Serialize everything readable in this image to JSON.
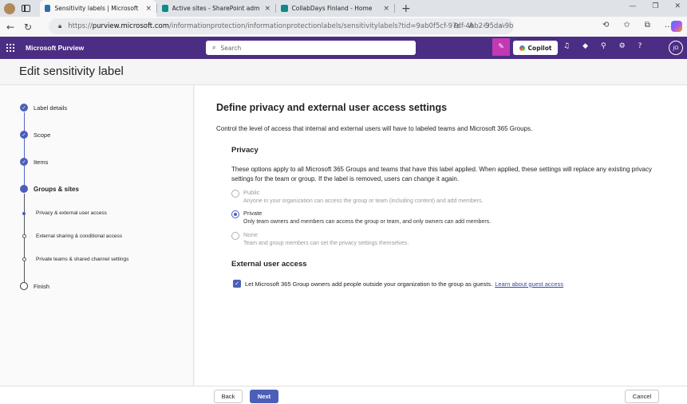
{
  "browser": {
    "tabs": [
      {
        "label": "Sensitivity labels | Microsoft Purv...",
        "active": true,
        "favicon_color": "#2b6cb0"
      },
      {
        "label": "Active sites - SharePoint admin c...",
        "active": false,
        "favicon_color": "#0f8a8a"
      },
      {
        "label": "CollabDays Finland - Home",
        "active": false,
        "favicon_color": "#0f8a8a"
      }
    ],
    "close_glyph": "×",
    "new_tab_glyph": "+",
    "url_prefix": "https://",
    "url_host": "purview.microsoft.com",
    "url_path": "/informationprotection/informationprotectionlabels/sensitivitylabels?tid=9ab0f5cf-97df-4bb2-95da-9bb492a2..."
  },
  "app": {
    "name": "Microsoft Purview",
    "search_placeholder": "Search",
    "copilot_label": "Copilot",
    "avatar_initials": "JO",
    "brand_color": "#4b2e83",
    "accent_color": "#4c5fb8"
  },
  "page": {
    "title": "Edit sensitivity label"
  },
  "stepper": {
    "steps": [
      {
        "label": "Label details",
        "state": "done"
      },
      {
        "label": "Scope",
        "state": "done"
      },
      {
        "label": "Items",
        "state": "done"
      },
      {
        "label": "Groups & sites",
        "state": "current"
      },
      {
        "label": "Privacy & external user access",
        "state": "sub-current"
      },
      {
        "label": "External sharing & conditional access",
        "state": "sub"
      },
      {
        "label": "Private teams & shared channel settings",
        "state": "sub"
      },
      {
        "label": "Finish",
        "state": "todo"
      }
    ]
  },
  "main": {
    "heading": "Define privacy and external user access settings",
    "intro": "Control the level of access that internal and external users will have to labeled teams and Microsoft 365 Groups.",
    "privacy": {
      "heading": "Privacy",
      "description": "These options apply to all Microsoft 365 Groups and teams that have this label applied. When applied, these settings will replace any existing privacy settings for the team or group. If the label is removed, users can change it again.",
      "options": [
        {
          "title": "Public",
          "description": "Anyone in your organization can access the group or team (including content) and add members.",
          "selected": false
        },
        {
          "title": "Private",
          "description": "Only team owners and members can access the group or team, and only owners can add members.",
          "selected": true
        },
        {
          "title": "None",
          "description": "Team and group members can set the privacy settings themselves.",
          "selected": false
        }
      ]
    },
    "external": {
      "heading": "External user access",
      "checkbox_label": "Let Microsoft 365 Group owners add people outside your organization to the group as guests.",
      "checked": true,
      "link_text": "Learn about guest access"
    }
  },
  "footer": {
    "back_label": "Back",
    "next_label": "Next",
    "cancel_label": "Cancel"
  }
}
